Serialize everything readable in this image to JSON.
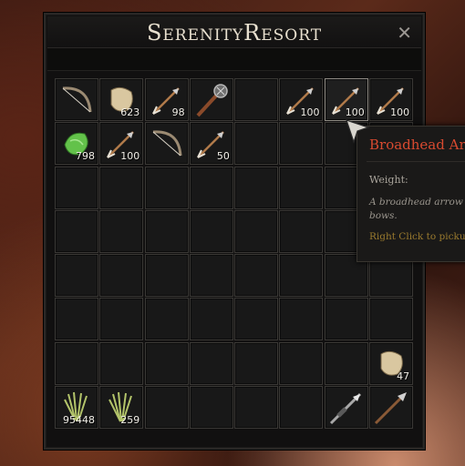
{
  "window": {
    "title": "SerenityResort",
    "close_icon": "close-icon"
  },
  "inventory": {
    "columns": 8,
    "rows": 8,
    "slots": [
      {
        "index": 0,
        "icon": "bow-icon",
        "qty": ""
      },
      {
        "index": 1,
        "icon": "hide-icon",
        "qty": "623"
      },
      {
        "index": 2,
        "icon": "arrow-icon",
        "qty": "98"
      },
      {
        "index": 3,
        "icon": "torch-icon",
        "qty": ""
      },
      {
        "index": 5,
        "icon": "arrow-icon",
        "qty": "100"
      },
      {
        "index": 6,
        "icon": "arrow-icon",
        "qty": "100",
        "selected": true
      },
      {
        "index": 7,
        "icon": "arrow-icon",
        "qty": "100"
      },
      {
        "index": 8,
        "icon": "fiber-icon",
        "qty": "798"
      },
      {
        "index": 9,
        "icon": "arrow-icon",
        "qty": "100"
      },
      {
        "index": 10,
        "icon": "bow-icon",
        "qty": ""
      },
      {
        "index": 11,
        "icon": "arrow-icon",
        "qty": "50"
      },
      {
        "index": 55,
        "icon": "hide-icon",
        "qty": "47"
      },
      {
        "index": 56,
        "icon": "thatch-icon",
        "qty": "95448"
      },
      {
        "index": 57,
        "icon": "thatch-icon",
        "qty": "259"
      },
      {
        "index": 62,
        "icon": "spear-icon",
        "qty": ""
      },
      {
        "index": 63,
        "icon": "pike-icon",
        "qty": ""
      }
    ]
  },
  "tooltip": {
    "name": "Broadhead Ar",
    "weight_label": "Weight:",
    "description": "A broadhead arrow t\nbows.",
    "hint": "Right Click to pickup"
  },
  "colors": {
    "tooltip_name": "#d84a30",
    "hint": "#9a7a2e"
  }
}
